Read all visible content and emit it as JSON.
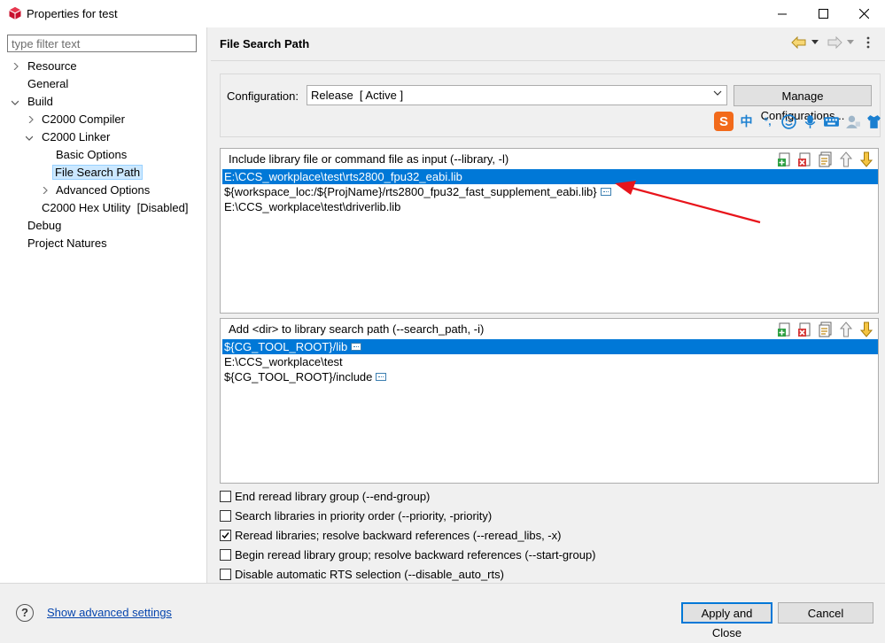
{
  "window": {
    "title": "Properties for test"
  },
  "filter": {
    "placeholder": "type filter text"
  },
  "tree": {
    "resource": "Resource",
    "general": "General",
    "build": "Build",
    "c2000_compiler": "C2000 Compiler",
    "c2000_linker": "C2000 Linker",
    "basic_options": "Basic Options",
    "file_search_path": "File Search Path",
    "advanced_options": "Advanced Options",
    "hex_utility": "C2000 Hex Utility  [Disabled]",
    "debug": "Debug",
    "project_natures": "Project Natures"
  },
  "page": {
    "title": "File Search Path"
  },
  "config": {
    "label": "Configuration:",
    "value": "Release  [ Active ]",
    "manage_label": "Manage Configurations..."
  },
  "include_list": {
    "title": "Include library file or command file as input (--library, -l)",
    "items": [
      "E:\\CCS_workplace\\test\\rts2800_fpu32_eabi.lib",
      "${workspace_loc:/${ProjName}/rts2800_fpu32_fast_supplement_eabi.lib}",
      "E:\\CCS_workplace\\test\\driverlib.lib"
    ]
  },
  "search_list": {
    "title": "Add <dir> to library search path (--search_path, -i)",
    "items": [
      "${CG_TOOL_ROOT}/lib",
      "E:\\CCS_workplace\\test",
      "${CG_TOOL_ROOT}/include"
    ]
  },
  "checkboxes": [
    {
      "label": "End reread library group (--end-group)",
      "checked": false
    },
    {
      "label": "Search libraries in priority order (--priority, -priority)",
      "checked": false
    },
    {
      "label": "Reread libraries; resolve backward references (--reread_libs, -x)",
      "checked": true
    },
    {
      "label": "Begin reread library group; resolve backward references (--start-group)",
      "checked": false
    },
    {
      "label": "Disable automatic RTS selection (--disable_auto_rts)",
      "checked": false
    }
  ],
  "footer": {
    "advanced_link": "Show advanced settings",
    "help_glyph": "?",
    "apply_label": "Apply and Close",
    "cancel_label": "Cancel"
  },
  "ime": {
    "logo": "S",
    "chinese": "中",
    "punct": "°,"
  },
  "colors": {
    "selection": "#0078d7",
    "tree_selection": "#cce8ff",
    "annotation_arrow": "#e8141b",
    "ime_logo": "#f26a1b",
    "ime_icons": "#1a7fd0"
  }
}
